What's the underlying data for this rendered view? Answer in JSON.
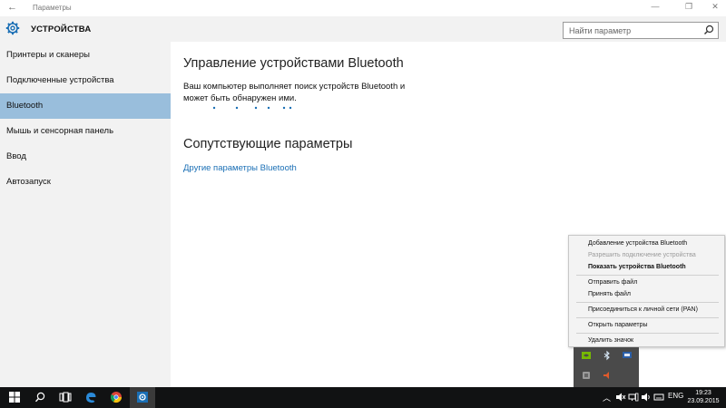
{
  "window": {
    "title": "Параметры",
    "back_icon": "←",
    "minimize_icon": "—",
    "maximize_icon": "❐",
    "close_icon": "✕"
  },
  "sidebar": {
    "header": "УСТРОЙСТВА",
    "items": [
      {
        "label": "Принтеры и сканеры",
        "active": false
      },
      {
        "label": "Подключенные устройства",
        "active": false
      },
      {
        "label": "Bluetooth",
        "active": true
      },
      {
        "label": "Мышь и сенсорная панель",
        "active": false
      },
      {
        "label": "Ввод",
        "active": false
      },
      {
        "label": "Автозапуск",
        "active": false
      }
    ]
  },
  "search": {
    "placeholder": "Найти параметр"
  },
  "main": {
    "heading": "Управление устройствами Bluetooth",
    "description": "Ваш компьютер выполняет поиск устройств Bluetooth и может быть обнаружен ими.",
    "related_heading": "Сопутствующие параметры",
    "related_link": "Другие параметры Bluetooth"
  },
  "context_menu": {
    "items": [
      {
        "label": "Добавление устройства Bluetooth",
        "state": "normal"
      },
      {
        "label": "Разрешить подключение устройства",
        "state": "disabled"
      },
      {
        "label": "Показать устройства Bluetooth",
        "state": "bold"
      },
      {
        "label": "Отправить файл",
        "state": "normal"
      },
      {
        "label": "Принять файл",
        "state": "normal"
      },
      {
        "label": "Присоединиться к личной сети (PAN)",
        "state": "normal"
      },
      {
        "label": "Открыть параметры",
        "state": "normal"
      },
      {
        "label": "Удалить значок",
        "state": "normal"
      }
    ]
  },
  "taskbar": {
    "language": "ENG",
    "time": "19:23",
    "date": "23.09.2015"
  },
  "colors": {
    "accent": "#1a6fb5",
    "sidebar_selected": "#99bedc",
    "sidebar_bg": "#f2f2f2",
    "taskbar": "#111213"
  }
}
